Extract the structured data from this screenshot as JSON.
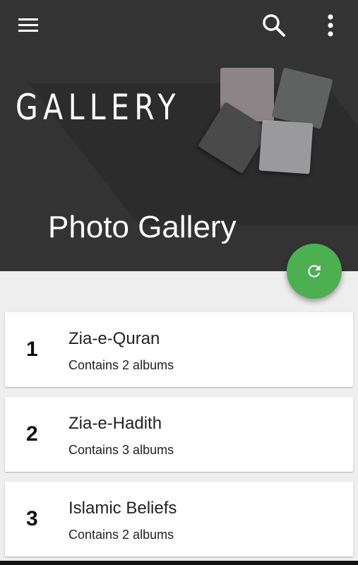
{
  "toolbar": {
    "menu_icon": "menu-icon",
    "search_icon": "search-icon",
    "more_icon": "more-vert-icon"
  },
  "header": {
    "logo_text": "GALLERY",
    "title": "Photo Gallery"
  },
  "fab": {
    "icon": "refresh-icon",
    "color": "#4caf50"
  },
  "categories": [
    {
      "number": "1",
      "title": "Zia-e-Quran",
      "subtitle": "Contains 2 albums"
    },
    {
      "number": "2",
      "title": "Zia-e-Hadith",
      "subtitle": "Contains 3 albums"
    },
    {
      "number": "3",
      "title": "Islamic Beliefs",
      "subtitle": "Contains 2 albums"
    }
  ],
  "colors": {
    "header_bg": "#333333",
    "page_bg": "#eeeeee",
    "card_bg": "#ffffff",
    "accent": "#4caf50"
  }
}
